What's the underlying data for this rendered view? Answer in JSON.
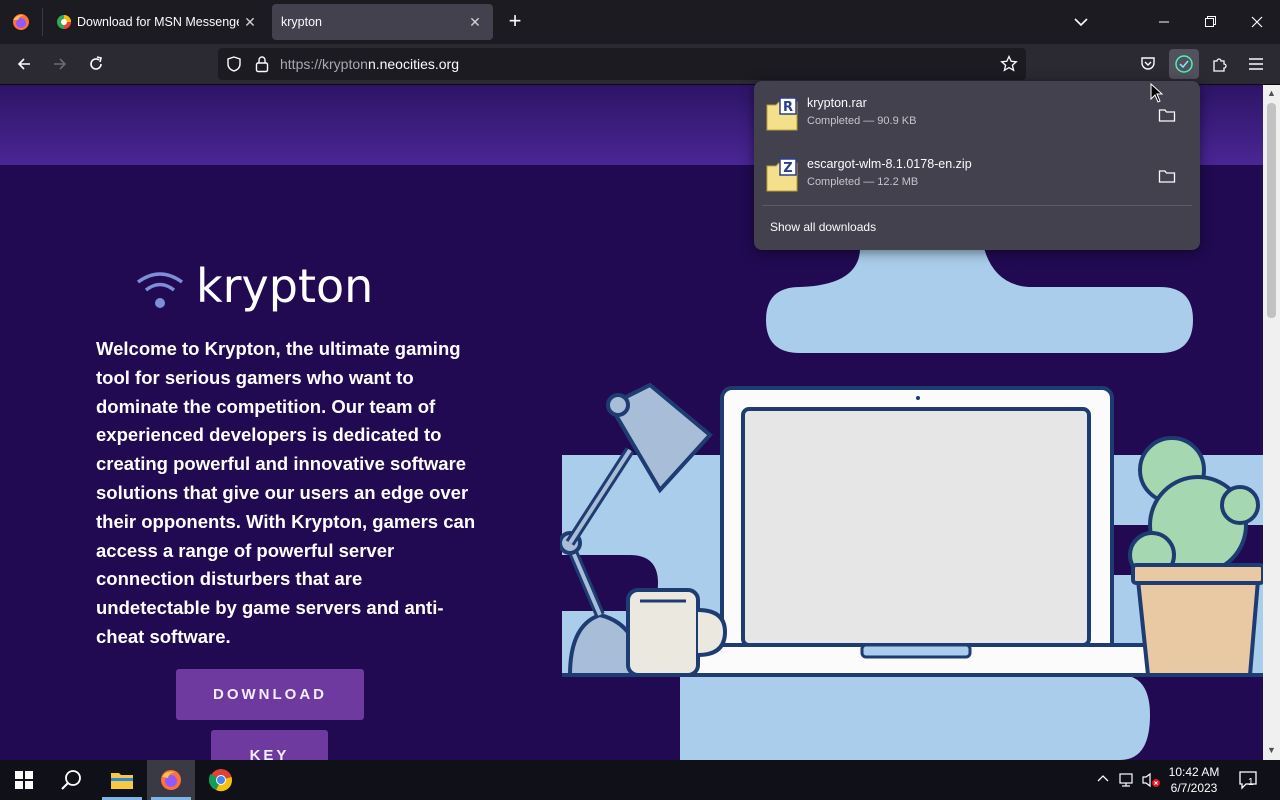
{
  "browser": {
    "tabs": [
      {
        "title": "Download for MSN Messenger",
        "active": false
      },
      {
        "title": "krypton",
        "active": true
      }
    ],
    "url_prefix": "https://krypton",
    "url_domain": "n.neocities.org"
  },
  "downloads": {
    "items": [
      {
        "name": "krypton.rar",
        "status": "Completed — 90.9 KB",
        "badge": "R"
      },
      {
        "name": "escargot-wlm-8.1.0178-en.zip",
        "status": "Completed — 12.2 MB",
        "badge": "Z"
      }
    ],
    "show_all": "Show all downloads"
  },
  "page": {
    "logo_text": "krypton",
    "welcome_text": "Welcome to Krypton, the ultimate gaming tool for serious gamers who want to dominate the competition. Our team of experienced developers is dedicated to creating powerful and innovative software solutions that give our users an edge over their opponents. With Krypton, gamers can access a range of powerful server connection disturbers that are undetectable by game servers and anti-cheat software.",
    "download_label": "DOWNLOAD",
    "key_label": "KEY"
  },
  "taskbar": {
    "time": "10:42 AM",
    "date": "6/7/2023",
    "notification_count": "1"
  },
  "colors": {
    "page_bg": "#210a52",
    "button_bg": "#6f3aa0",
    "blob": "#a9cdea"
  }
}
